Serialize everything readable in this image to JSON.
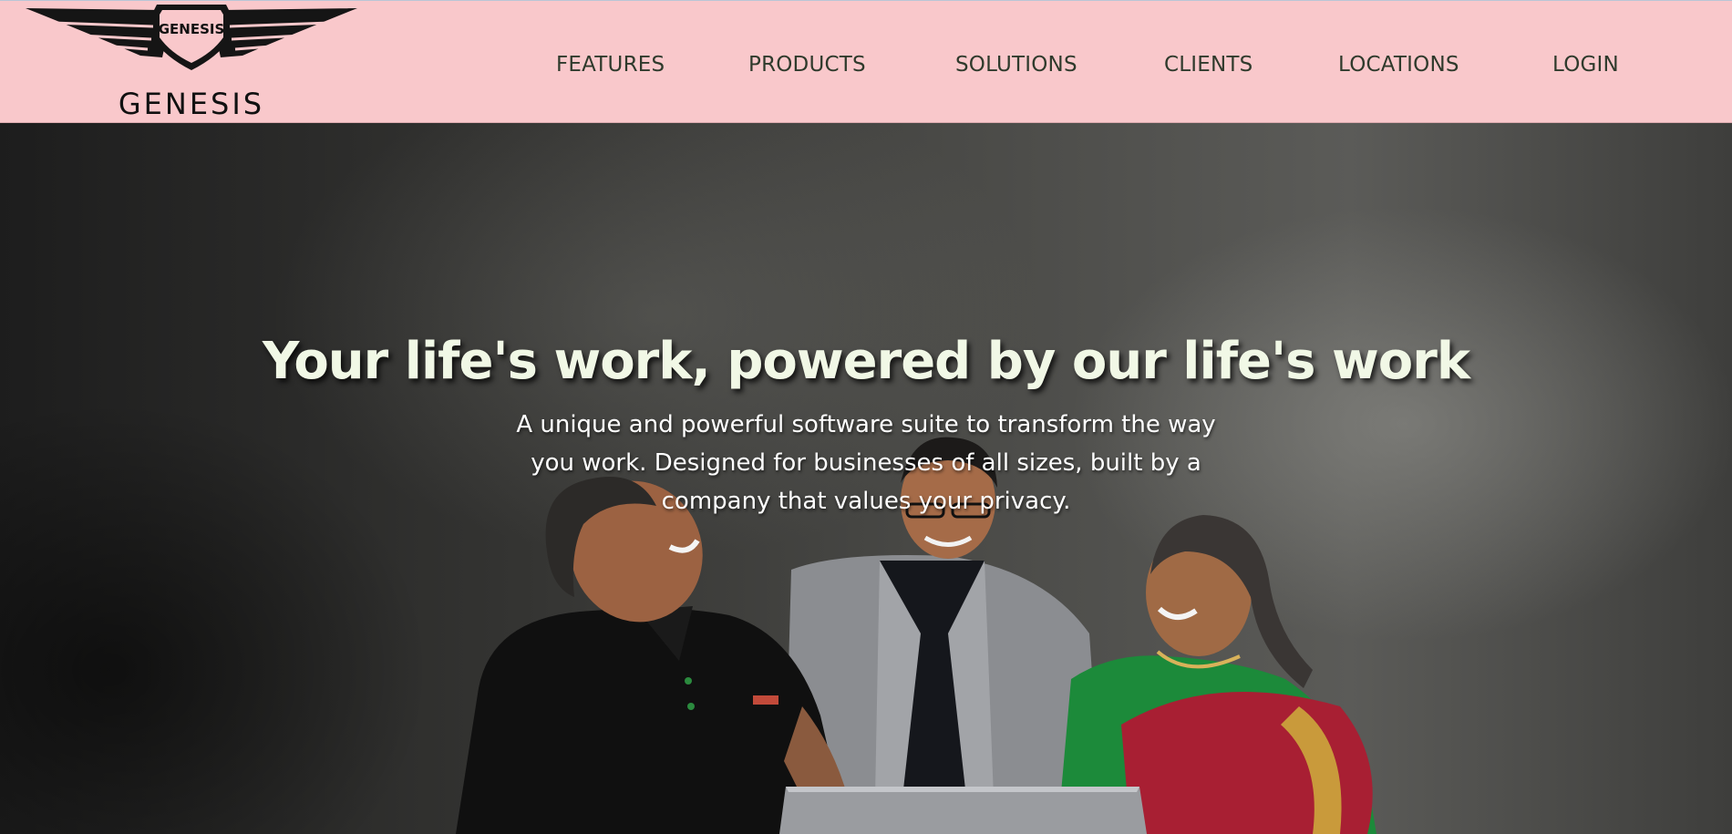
{
  "brand": {
    "emblem_text": "GENESIS",
    "wordmark": "GENESIS"
  },
  "nav": {
    "features": "FEATURES",
    "products": "PRODUCTS",
    "solutions": "SOLUTIONS",
    "clients": "CLIENTS",
    "locations": "LOCATIONS",
    "login": "LOGIN"
  },
  "hero": {
    "title": "Your life's work, powered by our life's work",
    "subtitle": "A unique and powerful software suite to transform the way you work. Designed for businesses of all sizes, built by a company that values your privacy."
  },
  "colors": {
    "header_bg": "#f9c8cb",
    "nav_text": "#2f3a2c",
    "hero_title": "#f1f8e6",
    "hero_bg": "#3a3a38"
  }
}
